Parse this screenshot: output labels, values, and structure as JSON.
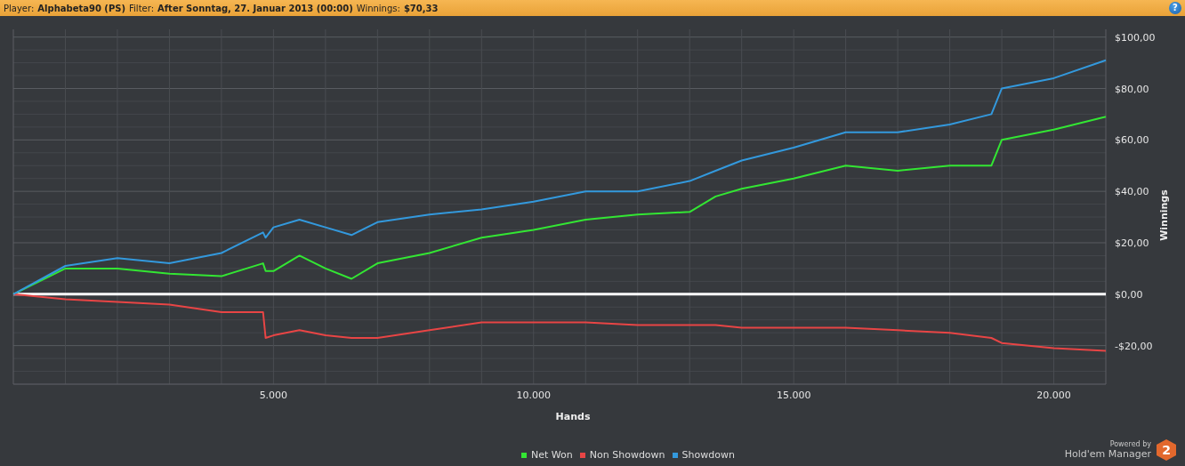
{
  "header": {
    "fields": [
      {
        "label": "Player:",
        "value": "Alphabeta90 (PS)"
      },
      {
        "label": "Filter:",
        "value": "After Sonntag, 27. Januar 2013 (00:00)"
      },
      {
        "label": "Winnings:",
        "value": "$70,33"
      }
    ],
    "help": "?"
  },
  "chart_data": {
    "type": "line",
    "xlabel": "Hands",
    "ylabel": "Winnings",
    "x": [
      0,
      1000,
      2000,
      3000,
      4000,
      4800,
      4850,
      5000,
      5500,
      6000,
      6500,
      7000,
      8000,
      9000,
      10000,
      11000,
      12000,
      13000,
      13500,
      14000,
      15000,
      16000,
      17000,
      18000,
      18800,
      19000,
      20000,
      21000
    ],
    "series": [
      {
        "name": "Net Won",
        "color": "#33e633",
        "values": [
          0,
          10,
          10,
          8,
          7,
          12,
          9,
          9,
          15,
          10,
          6,
          12,
          16,
          22,
          25,
          29,
          31,
          32,
          38,
          41,
          45,
          50,
          48,
          50,
          50,
          60,
          64,
          69
        ]
      },
      {
        "name": "Non Showdown",
        "color": "#e84545",
        "values": [
          0,
          -2,
          -3,
          -4,
          -7,
          -7,
          -17,
          -16,
          -14,
          -16,
          -17,
          -17,
          -14,
          -11,
          -11,
          -11,
          -12,
          -12,
          -12,
          -13,
          -13,
          -13,
          -14,
          -15,
          -17,
          -19,
          -21,
          -22
        ]
      },
      {
        "name": "Showdown",
        "color": "#3399dd",
        "values": [
          0,
          11,
          14,
          12,
          16,
          24,
          22,
          26,
          29,
          26,
          23,
          28,
          31,
          33,
          36,
          40,
          40,
          44,
          48,
          52,
          57,
          63,
          63,
          66,
          70,
          80,
          84,
          91
        ]
      }
    ],
    "grid": true,
    "xlim": [
      0,
      21000
    ],
    "ylim": [
      -35,
      103
    ],
    "xticks": [
      {
        "value": 5000,
        "label": "5.000"
      },
      {
        "value": 10000,
        "label": "10.000"
      },
      {
        "value": 15000,
        "label": "15.000"
      },
      {
        "value": 20000,
        "label": "20.000"
      }
    ],
    "yticks": [
      {
        "value": 100,
        "label": "$100,00"
      },
      {
        "value": 80,
        "label": "$80,00"
      },
      {
        "value": 60,
        "label": "$60,00"
      },
      {
        "value": 40,
        "label": "$40,00"
      },
      {
        "value": 20,
        "label": "$20,00"
      },
      {
        "value": 0,
        "label": "$0,00"
      },
      {
        "value": -20,
        "label": "-$20,00"
      }
    ]
  },
  "branding": {
    "powered_by": "Powered by",
    "product": "Hold'em Manager",
    "version": "2"
  }
}
